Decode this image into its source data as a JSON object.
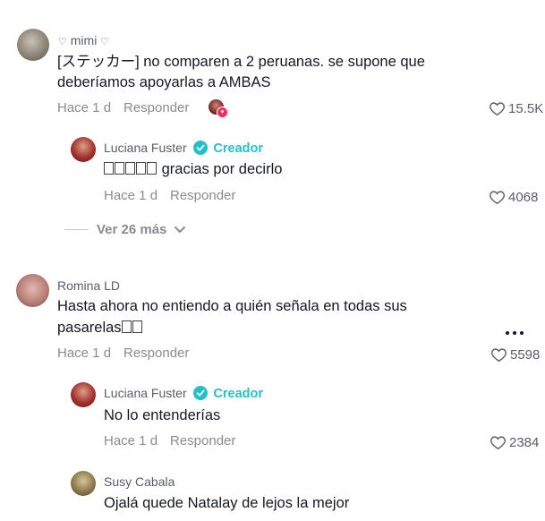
{
  "comments": [
    {
      "username": "mimi",
      "text_line1": "[ステッカー] no comparen a 2 peruanas. se supone que",
      "text_line2": "deberíamos apoyarlas a AMBAS",
      "time": "Hace 1 d",
      "reply_label": "Responder",
      "likes": "15.5K"
    },
    {
      "username": "Romina LD",
      "text_line1": "Hasta ahora no entiendo a quién señala en todas sus",
      "text_line2": "pasarelas",
      "time": "Hace 1 d",
      "reply_label": "Responder",
      "likes": "5598"
    },
    {
      "username": "Susy Cabala",
      "text_line1": "Ojalá quede Natalay de lejos la mejor"
    }
  ],
  "replies": [
    {
      "username": "Luciana Fuster",
      "badge": "Creador",
      "text": "gracias por decirlo",
      "time": "Hace 1 d",
      "reply_label": "Responder",
      "likes": "4068"
    },
    {
      "username": "Luciana Fuster",
      "badge": "Creador",
      "text": "No lo entenderías",
      "time": "Hace 1 d",
      "reply_label": "Responder",
      "likes": "2384"
    }
  ],
  "view_more": "Ver 26 más",
  "colors": {
    "creator": "#20c1c8",
    "text": "#161823",
    "meta": "#8a8b91",
    "heart_badge": "#fe2c55"
  }
}
